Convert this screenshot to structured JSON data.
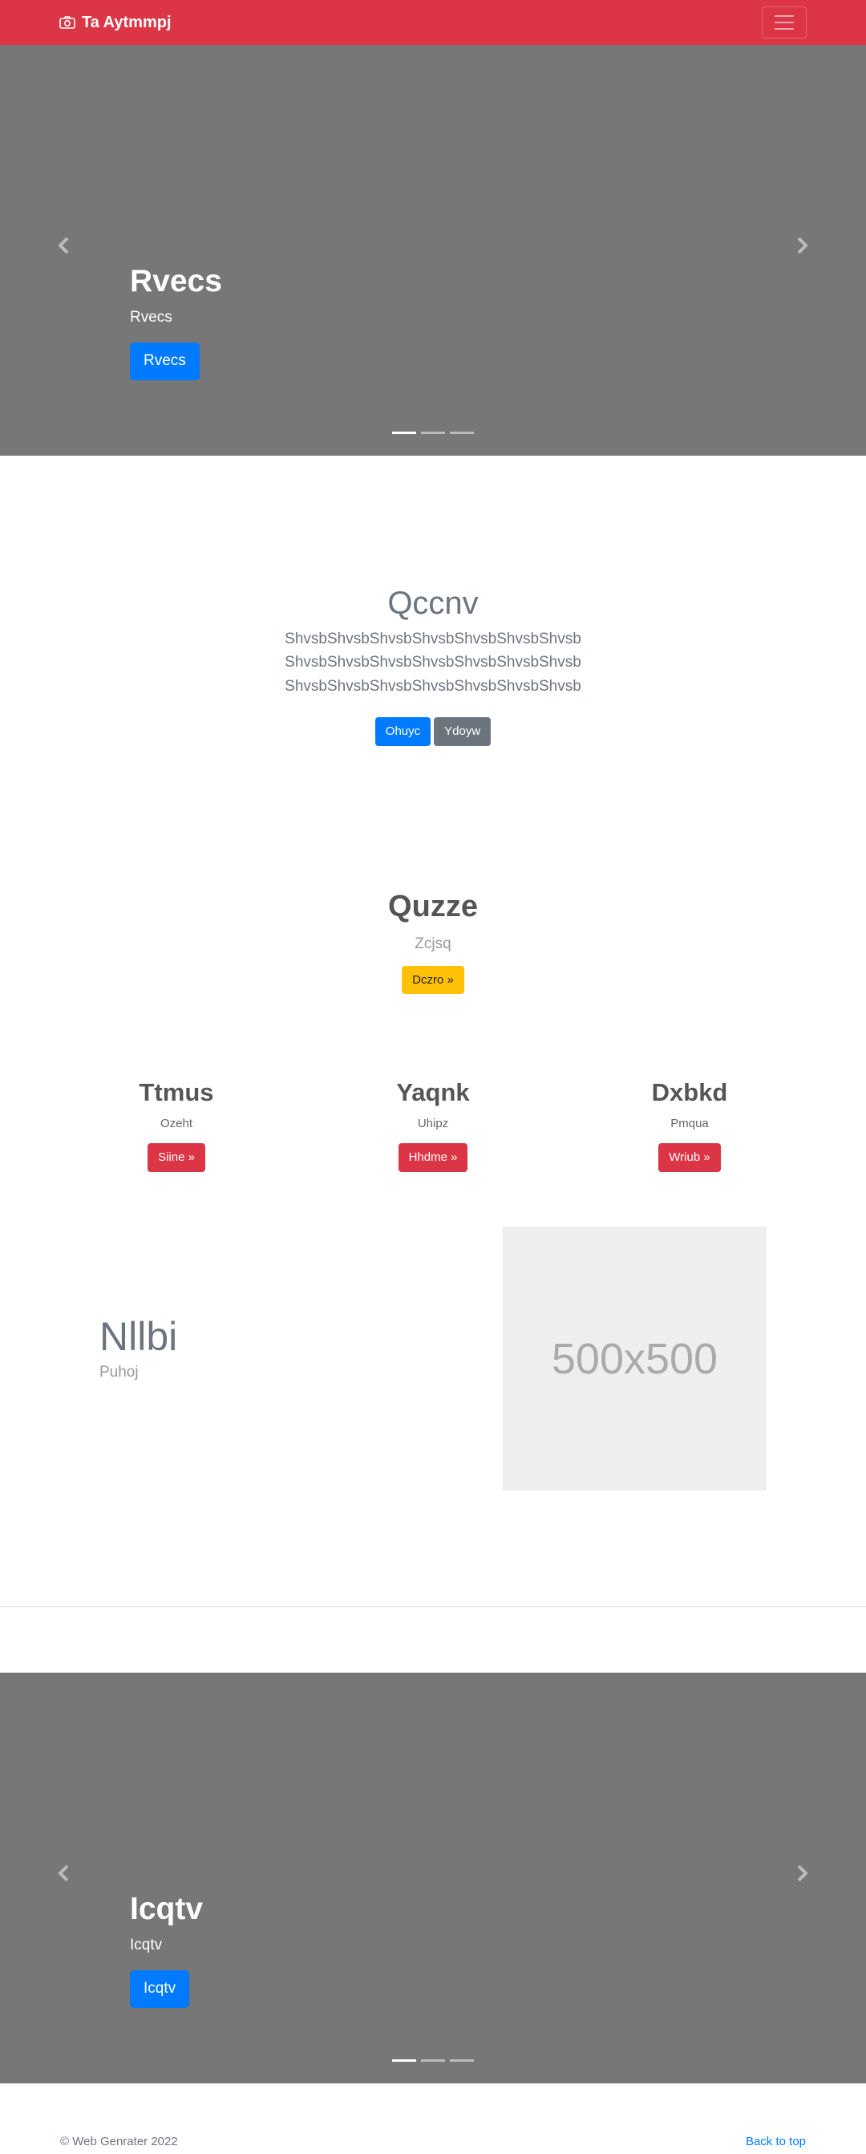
{
  "navbar": {
    "brand": "Ta Aytmmpj",
    "brand_icon": "camera-icon",
    "toggler_icon": "hamburger-icon",
    "background": "#dc3545"
  },
  "carousel_top": {
    "title": "Rvecs",
    "text": "Rvecs",
    "button": "Rvecs",
    "indicators": 3,
    "active_indicator": 1
  },
  "jumbotron": {
    "title": "Qccnv",
    "lead": "ShvsbShvsbShvsbShvsbShvsbShvsbShvsb ShvsbShvsbShvsbShvsbShvsbShvsbShvsb ShvsbShvsbShvsbShvsbShvsbShvsbShvsb",
    "primary_button": "Ohuyc",
    "secondary_button": "Ydoyw"
  },
  "feature": {
    "title": "Quzze",
    "text": "Zcjsq",
    "button": "Dczro »"
  },
  "columns": [
    {
      "title": "Ttmus",
      "text": "Ozeht",
      "button": "Siine »"
    },
    {
      "title": "Yaqnk",
      "text": "Uhipz",
      "button": "Hhdme »"
    },
    {
      "title": "Dxbkd",
      "text": "Pmqua",
      "button": "Wriub »"
    }
  ],
  "featurette": {
    "title": "Nllbi",
    "text": "Puhoj",
    "placeholder": "500x500"
  },
  "carousel_bottom": {
    "title": "Icqtv",
    "text": "Icqtv",
    "button": "Icqtv",
    "indicators": 3,
    "active_indicator": 1
  },
  "footer": {
    "copyright": "© Web Genrater 2022",
    "back_to_top": "Back to top"
  },
  "colors": {
    "primary": "#007bff",
    "danger": "#dc3545",
    "warning": "#ffc107",
    "secondary": "#6c757d",
    "carousel_bg": "#777777"
  }
}
